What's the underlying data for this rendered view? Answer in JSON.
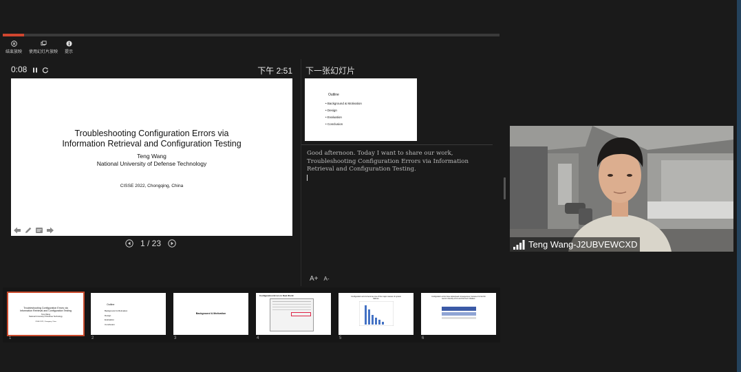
{
  "presentation": {
    "progress_fraction": 0.043,
    "toolbar": [
      {
        "name": "end-show-button",
        "label": "结束放映",
        "icon": "close-circle-icon"
      },
      {
        "name": "use-slideshow-button",
        "label": "使用幻灯片放映",
        "icon": "windows-icon"
      },
      {
        "name": "tips-button",
        "label": "提示",
        "icon": "info-icon"
      }
    ],
    "timer": "0:08",
    "clock": "下午 2:51",
    "current_slide": {
      "title_line1": "Troubleshooting Configuration Errors via",
      "title_line2": "Information Retrieval and Configuration Testing",
      "author": "Teng Wang",
      "affiliation": "National University of Defense Technology",
      "venue": "CISSE 2022, Chongqing, China"
    },
    "slide_counter": "1 / 23",
    "next_label": "下一张幻灯片",
    "next_slide": {
      "title": "Outline",
      "items": [
        "Background & Motivation",
        "Design",
        "Evaluation",
        "Conclusion"
      ]
    },
    "notes": "Good afternoon. Today I want to share our work, Troubleshooting Configuration Errors via Information Retrieval and Configuration Testing.",
    "font_increase": "A+",
    "font_decrease": "A-"
  },
  "filmstrip": {
    "thumbs": [
      {
        "num": "1",
        "line1": "Troubleshooting Configuration Errors via",
        "line2": "Information Retrieval and Configuration Testing",
        "line3": "Teng Wang",
        "line4": "National University of Defense Technology",
        "line5": "CISSE 2022, Chongqing, China"
      },
      {
        "num": "2",
        "title": "Outline",
        "items": [
          "Background & Motivation",
          "Design",
          "Evaluation",
          "Conclusion"
        ]
      },
      {
        "num": "3",
        "title": "Background & Motivation"
      },
      {
        "num": "4",
        "title": "Configuration Errors in Real World"
      },
      {
        "num": "5",
        "title": "Configuration errors become one of the major causes of system failures"
      },
      {
        "num": "6",
        "title": "Configuration errors have widespread consequences, because it's hard for users to identify errors and find their mistakes."
      }
    ]
  },
  "video": {
    "participant_name": "Teng Wang-J2UBVEWCXD",
    "signal_icon": "signal-bars-icon"
  }
}
